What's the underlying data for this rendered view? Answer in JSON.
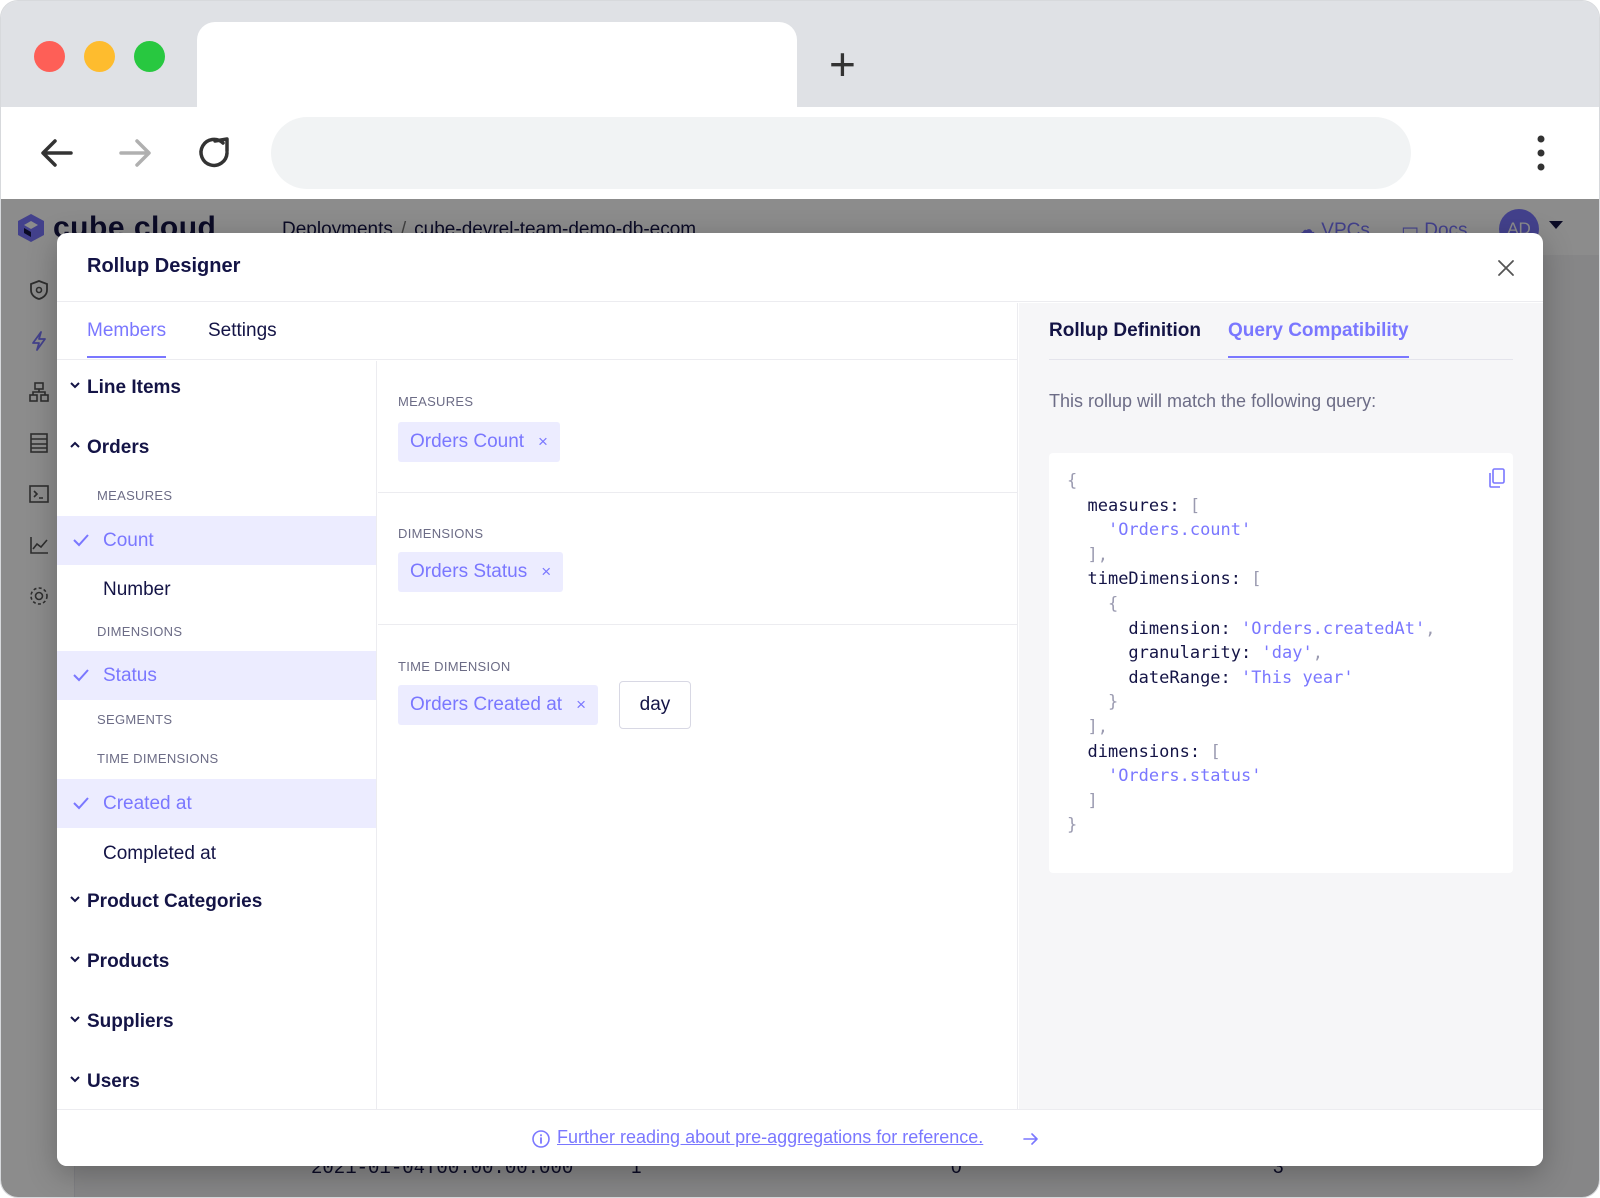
{
  "app": {
    "logo": "cube cloud",
    "breadcrumb": [
      "Deployments",
      "cube-devrel-team-demo-db-ecom"
    ],
    "breadcrumb_sep": "/",
    "header_links": [
      "VPCs",
      "Docs"
    ],
    "avatar": "AD",
    "background_row": {
      "date": "2021-01-04T00:00:00.000",
      "values": [
        "1",
        "0",
        "3"
      ]
    }
  },
  "modal": {
    "title": "Rollup Designer",
    "tabs": [
      "Members",
      "Settings"
    ],
    "active_tab": "Members",
    "tree": {
      "cubes": [
        {
          "name": "Line Items",
          "expanded": false
        },
        {
          "name": "Orders",
          "expanded": true
        },
        {
          "name": "Product Categories",
          "expanded": false
        },
        {
          "name": "Products",
          "expanded": false
        },
        {
          "name": "Suppliers",
          "expanded": false
        },
        {
          "name": "Users",
          "expanded": false
        }
      ],
      "groups": {
        "measures": "MEASURES",
        "dimensions": "DIMENSIONS",
        "segments": "SEGMENTS",
        "time_dimensions": "TIME DIMENSIONS"
      },
      "members": {
        "count": {
          "label": "Count",
          "selected": true
        },
        "number": {
          "label": "Number",
          "selected": false
        },
        "status": {
          "label": "Status",
          "selected": true
        },
        "created_at": {
          "label": "Created at",
          "selected": true
        },
        "completed_at": {
          "label": "Completed at",
          "selected": false
        }
      }
    },
    "selection": {
      "measures_title": "MEASURES",
      "measures": [
        "Orders Count"
      ],
      "dimensions_title": "DIMENSIONS",
      "dimensions": [
        "Orders Status"
      ],
      "time_dimension_title": "TIME DIMENSION",
      "time_dimension": "Orders Created at",
      "granularity": "day",
      "remove_symbol": "×"
    },
    "right": {
      "tabs": [
        "Rollup Definition",
        "Query Compatibility"
      ],
      "active_tab": "Query Compatibility",
      "description": "This rollup will match the following query:",
      "query": {
        "measures_key": "measures:",
        "measures": [
          "'Orders.count'"
        ],
        "time_dimensions_key": "timeDimensions:",
        "dimension_key": "dimension:",
        "dimension": "'Orders.createdAt'",
        "granularity_key": "granularity:",
        "granularity": "'day'",
        "date_range_key": "dateRange:",
        "date_range": "'This year'",
        "dimensions_key": "dimensions:",
        "dimensions": [
          "'Orders.status'"
        ]
      }
    },
    "footer_link": "Further reading about pre-aggregations for reference."
  },
  "colors": {
    "accent": "#7a77ff",
    "text": "#141446",
    "selected_bg": "#ececff"
  }
}
